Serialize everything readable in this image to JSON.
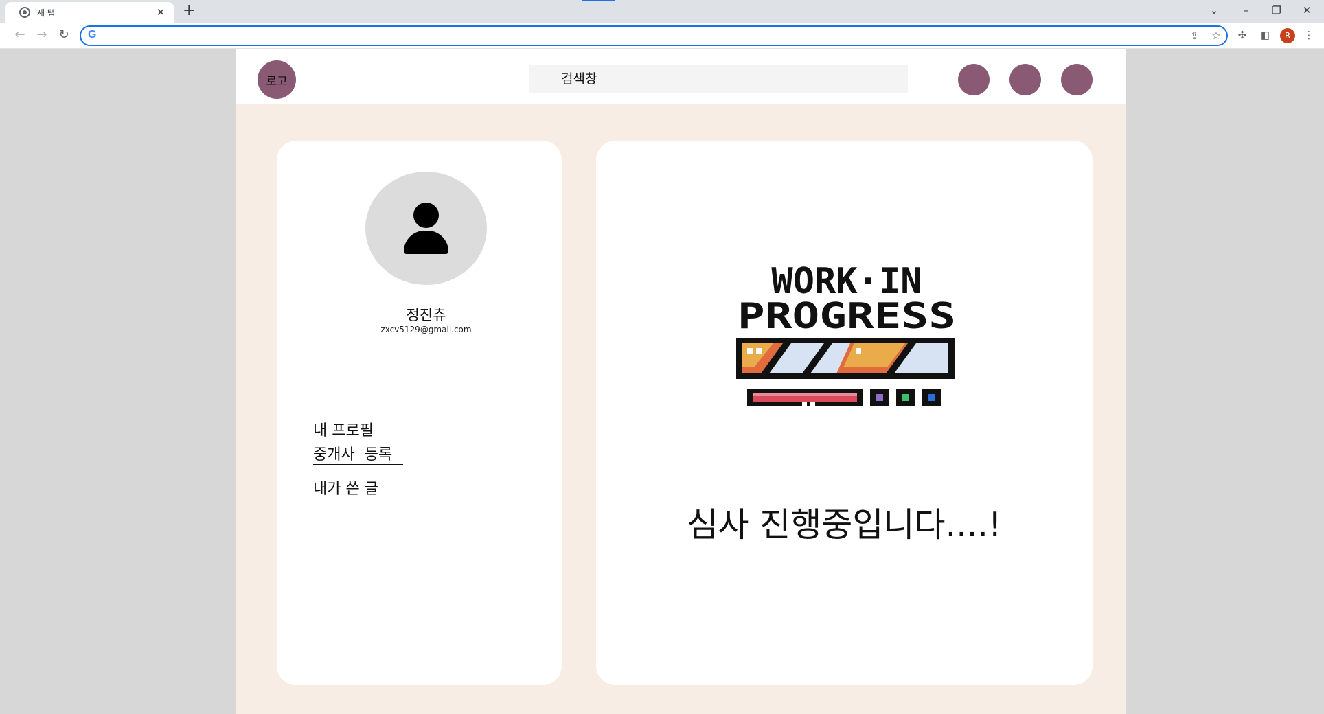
{
  "browser": {
    "tab_title": "새 탭",
    "tab_close": "✕",
    "new_tab": "+",
    "address_value": "",
    "profile_initial": "R",
    "icons": [
      "chrome-icon",
      "back-arrow-icon",
      "forward-arrow-icon",
      "reload-icon",
      "google-g-icon",
      "share-icon",
      "bookmark-star-icon",
      "extensions-puzzle-icon",
      "side-panel-icon",
      "kebab-menu-icon",
      "tab-search-chevron-icon",
      "minimize-icon",
      "restore-icon",
      "close-window-icon"
    ],
    "accent": "#1a73e8",
    "profile_color": "#c5401b"
  },
  "header": {
    "logo_label": "로고",
    "search_placeholder": "검색창",
    "circle_color": "#8a5a74"
  },
  "profile": {
    "name": "정진츄",
    "email": "zxcv5129@gmail.com",
    "avatar_icon": "person-icon"
  },
  "menu": {
    "items": [
      "내 프로필",
      "중개사  등록",
      "내가 쓴 글"
    ],
    "active_index": 1
  },
  "main": {
    "graphic": {
      "line1": "WORK·IN",
      "line2": "PROGRESS"
    },
    "status_message": "심사 진행중입니다....!"
  },
  "colors": {
    "page_background": "#f7ede4",
    "card": "#ffffff",
    "avatar_bg": "#dcdcdc"
  }
}
